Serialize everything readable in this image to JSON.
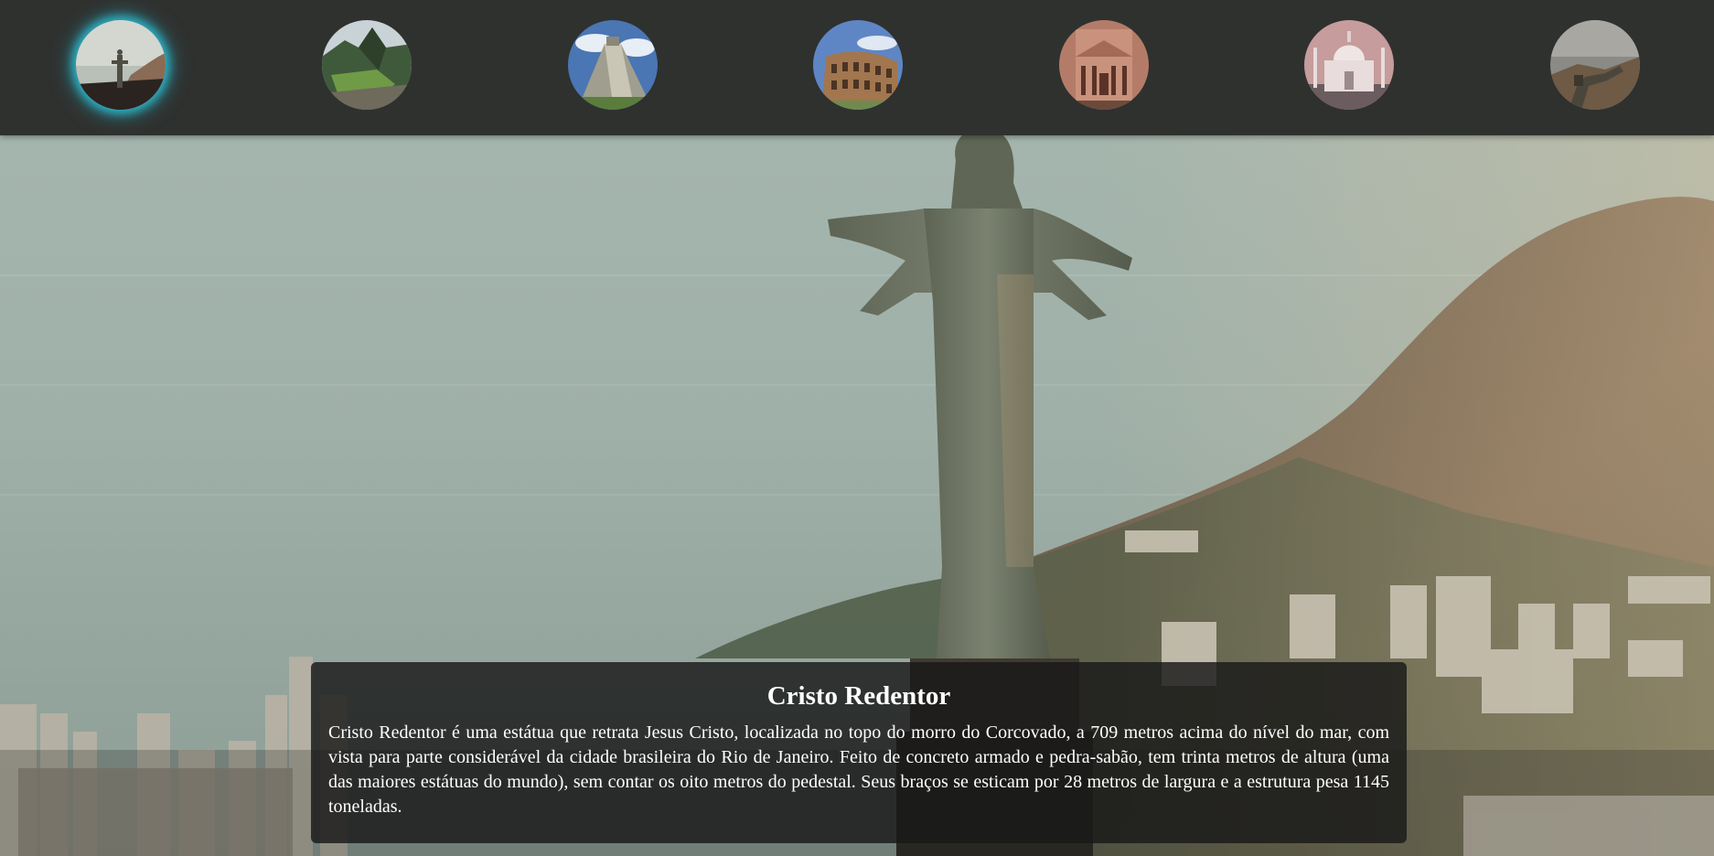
{
  "nav": {
    "thumbnails": [
      {
        "name": "Cristo Redentor",
        "icon": "christ-redeemer-thumbnail",
        "active": true
      },
      {
        "name": "Machu Picchu",
        "icon": "machu-picchu-thumbnail",
        "active": false
      },
      {
        "name": "Chichén Itzá",
        "icon": "chichen-itza-thumbnail",
        "active": false
      },
      {
        "name": "Coliseu",
        "icon": "colosseum-thumbnail",
        "active": false
      },
      {
        "name": "Petra",
        "icon": "petra-thumbnail",
        "active": false
      },
      {
        "name": "Taj Mahal",
        "icon": "taj-mahal-thumbnail",
        "active": false
      },
      {
        "name": "Muralha da China",
        "icon": "great-wall-thumbnail",
        "active": false
      }
    ],
    "active_glow_color": "#2bb3c7",
    "bar_color": "#2f312f"
  },
  "info": {
    "title": "Cristo Redentor",
    "description": "Cristo Redentor é uma estátua que retrata Jesus Cristo, localizada no topo do morro do Corcovado, a 709 metros acima do nível do mar, com vista para parte considerável da cidade brasileira do Rio de Janeiro. Feito de concreto armado e pedra-sabão, tem trinta metros de altura (uma das maiores estátuas do mundo), sem contar os oito metros do pedestal. Seus braços se esticam por 28 metros de largura e a estrutura pesa 1145 toneladas."
  }
}
